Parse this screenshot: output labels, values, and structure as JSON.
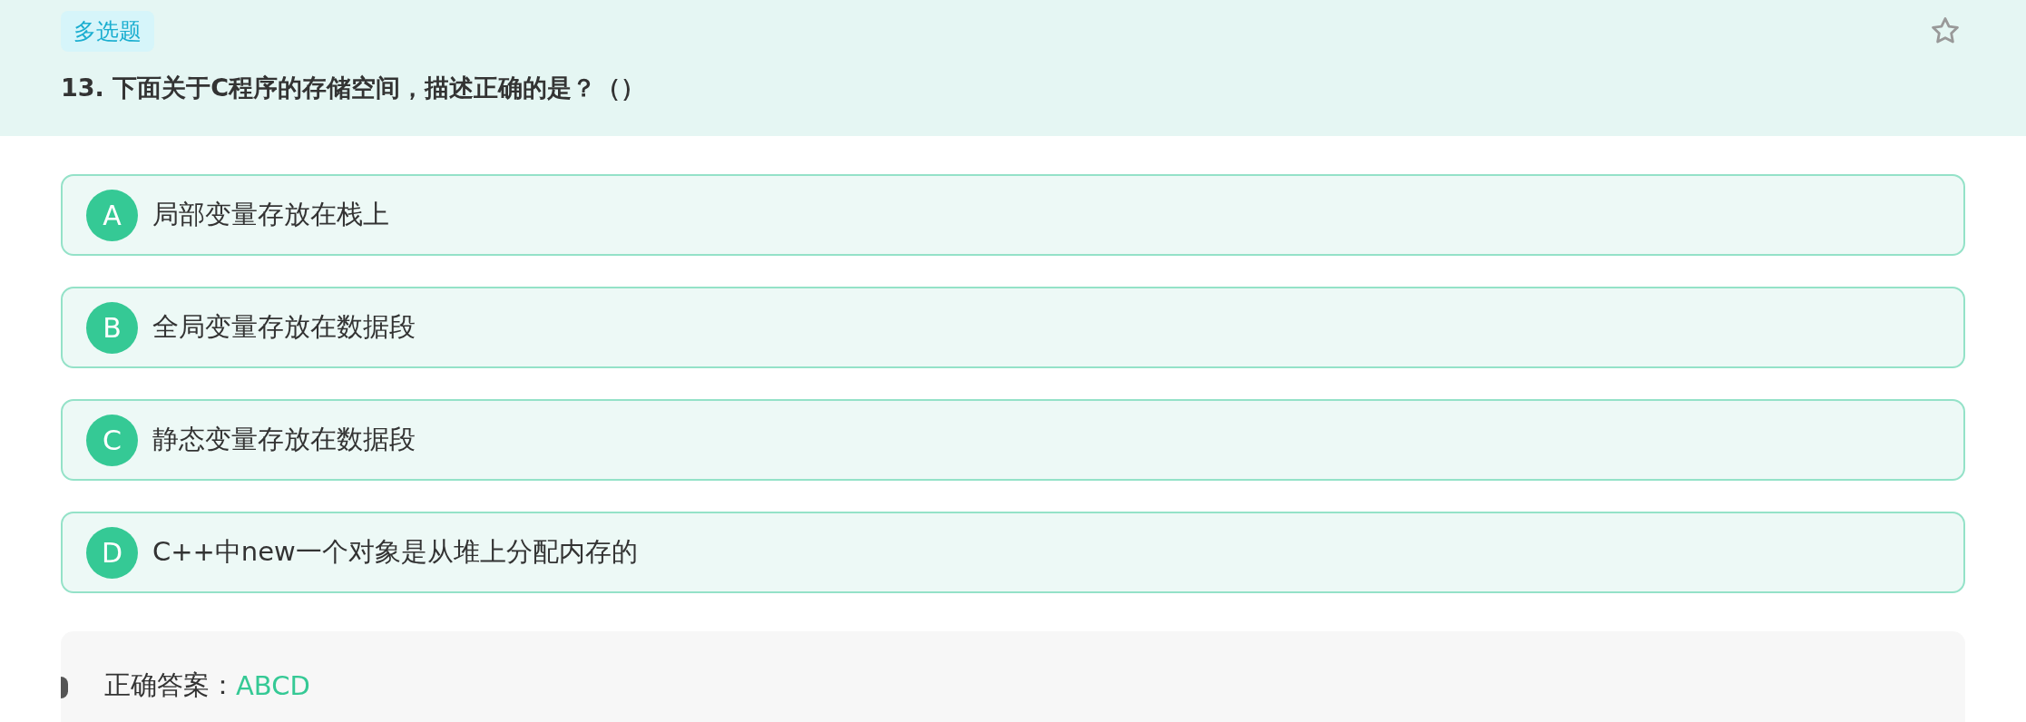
{
  "question": {
    "type_tag": "多选题",
    "title": "13. 下面关于C程序的存储空间，描述正确的是？（）"
  },
  "options": [
    {
      "letter": "A",
      "text": "局部变量存放在栈上"
    },
    {
      "letter": "B",
      "text": "全局变量存放在数据段"
    },
    {
      "letter": "C",
      "text": "静态变量存放在数据段"
    },
    {
      "letter": "D",
      "text": "C++中new一个对象是从堆上分配内存的"
    }
  ],
  "answer": {
    "label": "正确答案：",
    "value": "ABCD"
  }
}
